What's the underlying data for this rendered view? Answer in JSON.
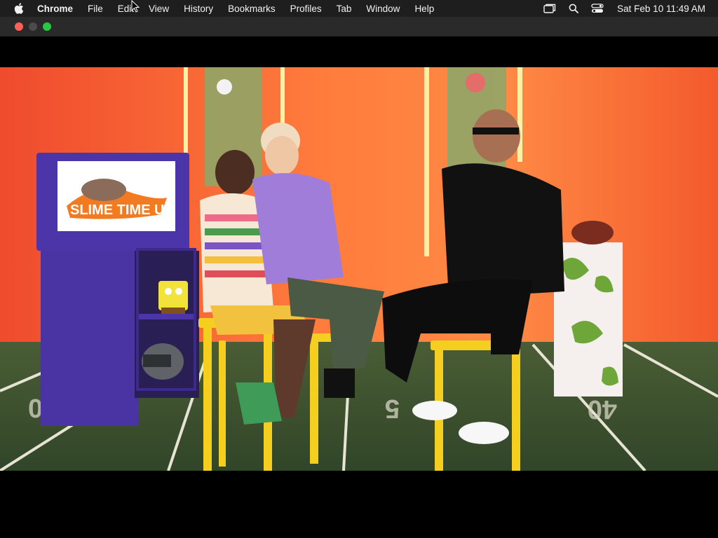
{
  "menubar": {
    "app_name": "Chrome",
    "items": [
      "File",
      "Edit",
      "View",
      "History",
      "Bookmarks",
      "Profiles",
      "Tab",
      "Window",
      "Help"
    ],
    "clock": "Sat Feb 10  11:49 AM",
    "status_icons": [
      "window-switcher-icon",
      "search-icon",
      "control-center-icon"
    ]
  },
  "window": {
    "controls": [
      "close",
      "minimize",
      "zoom"
    ]
  },
  "video": {
    "screen_logo_text": "SLIME TIME UK",
    "colors": {
      "wall": "#ff7a3b",
      "floor": "#3f5b35",
      "locker": "#4b35a8",
      "stool": "#f4cf1f"
    }
  }
}
